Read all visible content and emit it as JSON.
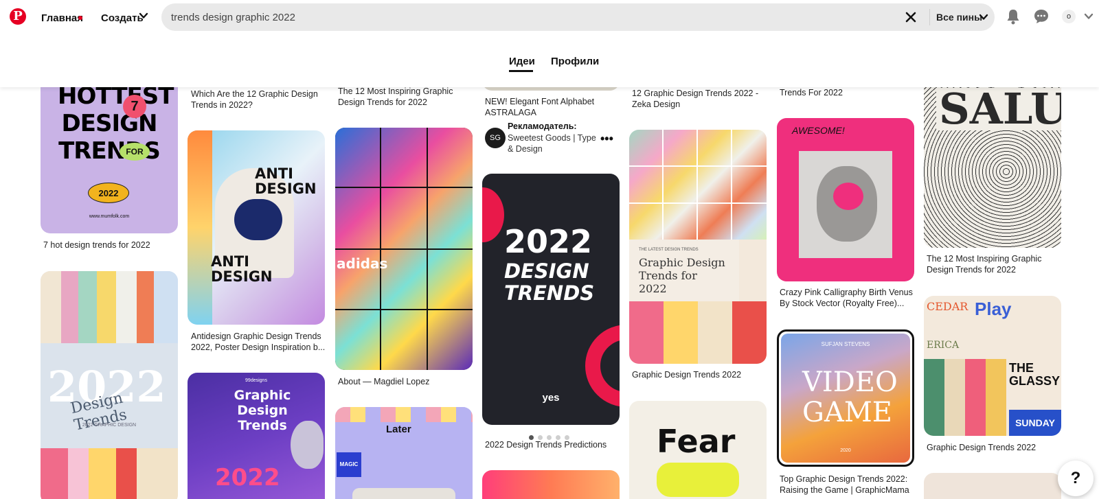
{
  "header": {
    "logo": "P",
    "home_label": "Главная",
    "create_label": "Создать",
    "search_value": "trends design graphic 2022",
    "filter_label": "Все пины",
    "avatar_initial": "o"
  },
  "tabs": {
    "ideas": "Идеи",
    "profiles": "Профили"
  },
  "pins": {
    "p1": {
      "caption": "7 hot design trends for 2022",
      "art_title": "HOTTEST DESIGN TRENDS",
      "art_badge": "7",
      "art_for": "FOR",
      "art_year": "2022",
      "art_url": "www.mumfolk.com"
    },
    "p2": {
      "caption": "Which Are the 12 Graphic Design Trends in 2022?"
    },
    "p3": {
      "caption": "Antidesign Graphic Design Trends 2022, Poster Design Inspiration b...",
      "art_top": "ANTI DESIGN",
      "art_bottom": "ANTI DESIGN"
    },
    "p4": {
      "art_brand": "99designs",
      "art_title": "Graphic Design Trends",
      "art_year": "2022"
    },
    "p5": {
      "caption": "The 12 Most Inspiring Graphic Design Trends for 2022"
    },
    "p6": {
      "caption": "About — Magdiel Lopez",
      "art_word": "adidas"
    },
    "p7": {
      "art_word": "Later",
      "art_tag": "MAGIC"
    },
    "p8": {
      "caption": "NEW! Elegant Font Alphabet ASTRALAGA",
      "advertiser_label": "Рекламодатель:",
      "advertiser_name": "Sweetest Goods | Type & Design",
      "advertiser_avatar": "SG"
    },
    "p9": {
      "caption": "2022 Design Trends Predictions",
      "art_year": "2022",
      "art_line1": "DESIGN",
      "art_line2": "TRENDS",
      "art_brand": "yes"
    },
    "p10": {
      "caption": "12 Graphic Design Trends 2022 - Zeka Design"
    },
    "p11": {
      "caption": "Graphic Design Trends 2022",
      "art_eyebrow": "THE LATEST DESIGN TRENDS",
      "art_title": "Graphic Design Trends for 2022"
    },
    "p12": {
      "art_word": "Fear"
    },
    "p13": {
      "caption": "Trends For 2022"
    },
    "p14": {
      "caption": "Crazy Pink Calligraphy Birth Venus By Stock Vector (Royalty Free)...",
      "art_word": "AWESOME!"
    },
    "p15": {
      "caption": "Top Graphic Design Trends 2022: Raising the Game | GraphicMama",
      "art_artist": "SUFJAN STEVENS",
      "art_title": "VIDEO GAME",
      "art_year": "2020"
    },
    "p16": {
      "caption": "The 12 Most Inspiring Graphic Design Trends for 2022",
      "art_word": "SALUT"
    },
    "p17": {
      "caption": "Graphic Design Trends 2022",
      "art_words": [
        "CEDAR",
        "Play",
        "ERICA",
        "THE GLASSY",
        "SUNDAY"
      ]
    },
    "p18": {
      "art_year": "2022",
      "art_title": "Design Trends",
      "art_sub": "2022 GRAPHIC DESIGN"
    }
  },
  "colors": {
    "brand_red": "#e60023"
  },
  "icons": [
    "pinterest-logo-icon",
    "chevron-down-icon",
    "close-icon",
    "bell-icon",
    "message-icon",
    "more-icon",
    "help-icon"
  ]
}
